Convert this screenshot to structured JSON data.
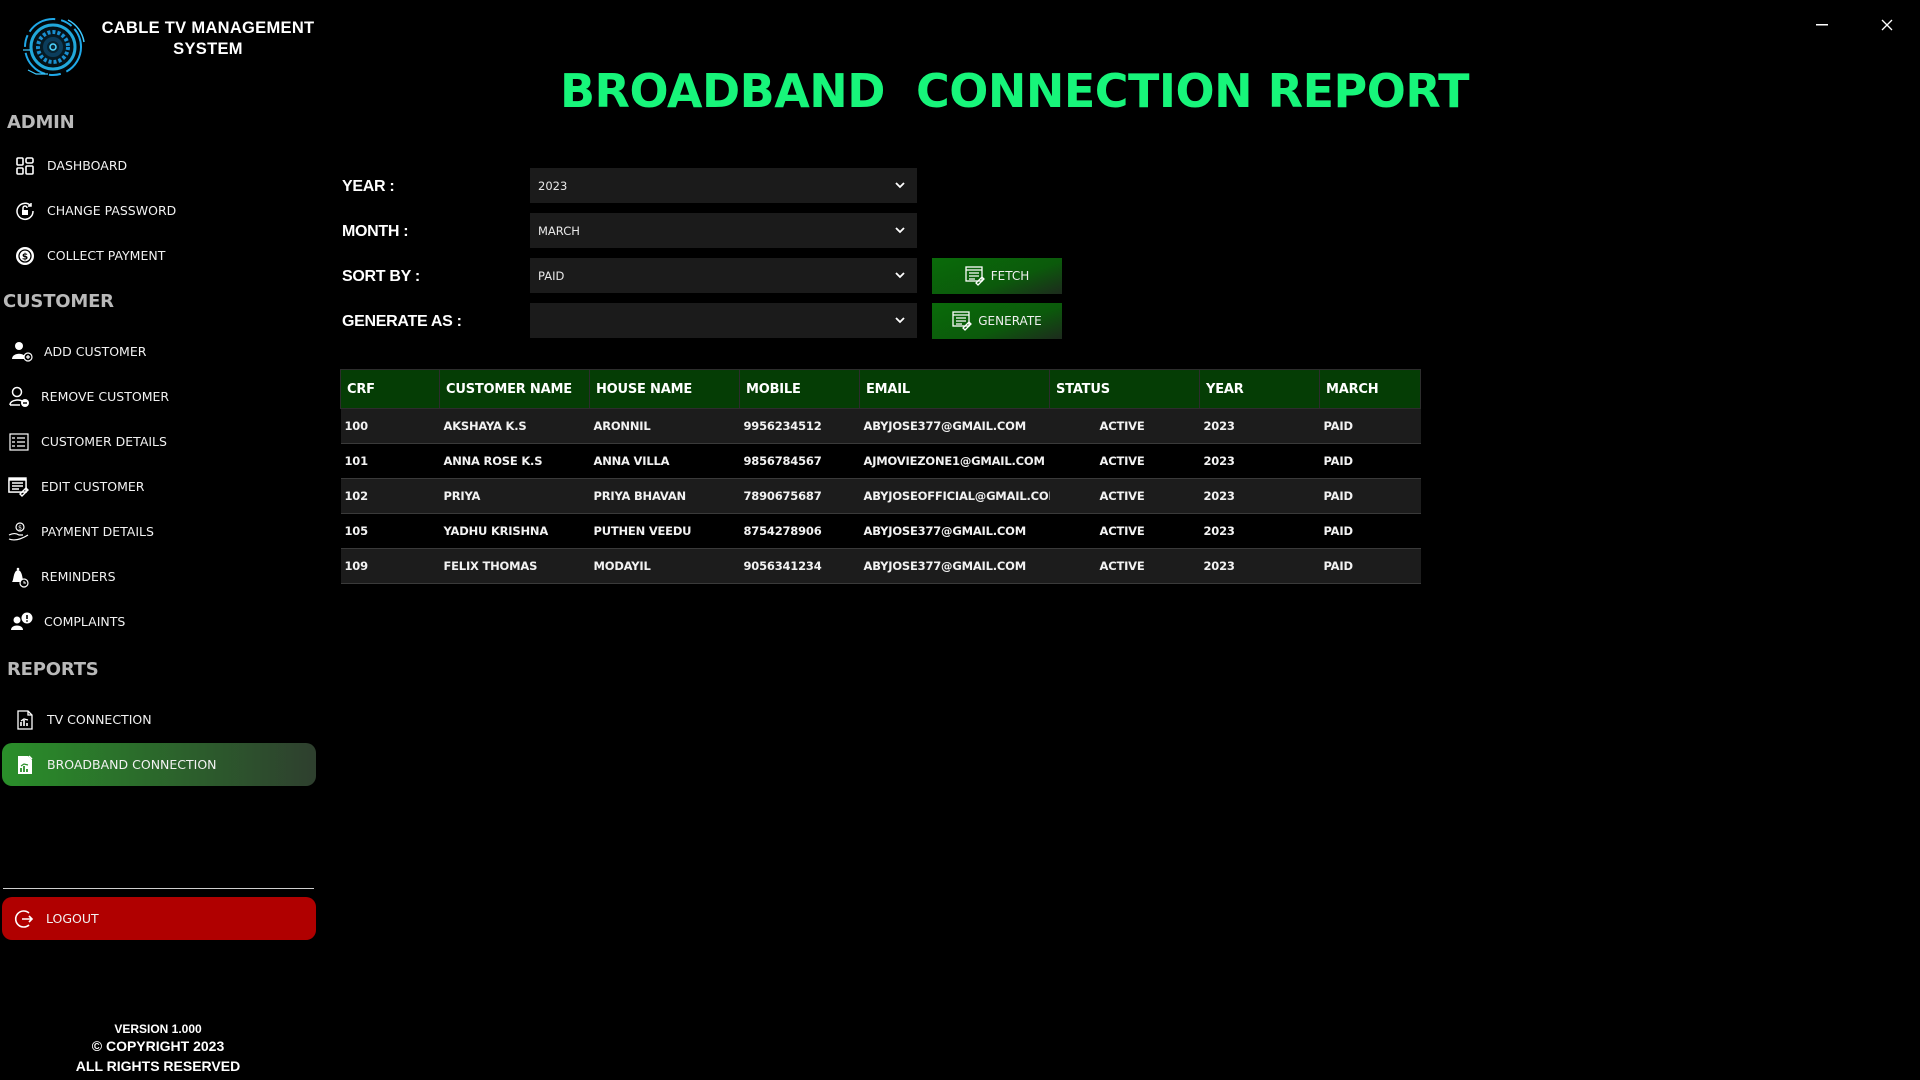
{
  "app": {
    "title_line1": "CABLE TV MANAGEMENT",
    "title_line2": "SYSTEM",
    "window_controls": {
      "minimize": "−",
      "close": "✕"
    }
  },
  "sidebar": {
    "sections": {
      "admin": "ADMIN",
      "customer": "CUSTOMER",
      "reports": "REPORTS"
    },
    "admin_items": [
      {
        "label": "DASHBOARD",
        "icon": "dashboard-icon"
      },
      {
        "label": "CHANGE PASSWORD",
        "icon": "unlock-icon"
      },
      {
        "label": "COLLECT PAYMENT",
        "icon": "coin-icon"
      }
    ],
    "customer_items": [
      {
        "label": "ADD CUSTOMER",
        "icon": "add-user-icon"
      },
      {
        "label": "REMOVE CUSTOMER",
        "icon": "remove-user-icon"
      },
      {
        "label": "CUSTOMER DETAILS",
        "icon": "details-list-icon"
      },
      {
        "label": "EDIT CUSTOMER",
        "icon": "edit-list-icon"
      },
      {
        "label": "PAYMENT DETAILS",
        "icon": "hand-coin-icon"
      },
      {
        "label": "REMINDERS",
        "icon": "bell-icon"
      },
      {
        "label": "COMPLAINTS",
        "icon": "complaint-icon"
      }
    ],
    "report_items": [
      {
        "label": "TV CONNECTION",
        "icon": "report-doc-icon",
        "active": false
      },
      {
        "label": "BROADBAND CONNECTION",
        "icon": "report-doc-icon",
        "active": true
      }
    ],
    "logout_label": "LOGOUT",
    "footer": {
      "version": "VERSION 1.000",
      "copyright": "© COPYRIGHT 2023",
      "rights": "ALL RIGHTS RESERVED"
    },
    "colors": {
      "active": "#2a8f2a",
      "logout": "#b00000"
    }
  },
  "main": {
    "title": "BROADBAND  CONNECTION REPORT",
    "title_color": "#17f57a",
    "form": {
      "year": {
        "label": "YEAR :",
        "value": "2023"
      },
      "month": {
        "label": "MONTH :",
        "value": "MARCH"
      },
      "sort_by": {
        "label": "SORT BY :",
        "value": "PAID"
      },
      "generate_as": {
        "label": "GENERATE AS :",
        "value": ""
      }
    },
    "buttons": {
      "fetch": "FETCH",
      "generate": "GENERATE"
    },
    "table": {
      "columns": [
        "CRF",
        "CUSTOMER NAME",
        "HOUSE NAME",
        "MOBILE",
        "EMAIL",
        "STATUS",
        "YEAR",
        "MARCH"
      ],
      "header_color": "#053d05",
      "rows": [
        [
          "100",
          "AKSHAYA K.S",
          "ARONNIL",
          "9956234512",
          "ABYJOSE377@GMAIL.COM",
          "ACTIVE",
          "2023",
          "PAID"
        ],
        [
          "101",
          "ANNA ROSE K.S",
          "ANNA VILLA",
          "9856784567",
          "AJMOVIEZONE1@GMAIL.COM",
          "ACTIVE",
          "2023",
          "PAID"
        ],
        [
          "102",
          "PRIYA",
          "PRIYA BHAVAN",
          "7890675687",
          "ABYJOSEOFFICIAL@GMAIL.COM",
          "ACTIVE",
          "2023",
          "PAID"
        ],
        [
          "105",
          "YADHU KRISHNA",
          "PUTHEN VEEDU",
          "8754278906",
          "ABYJOSE377@GMAIL.COM",
          "ACTIVE",
          "2023",
          "PAID"
        ],
        [
          "109",
          "FELIX THOMAS",
          "MODAYIL",
          "9056341234",
          "ABYJOSE377@GMAIL.COM",
          "ACTIVE",
          "2023",
          "PAID"
        ]
      ]
    }
  }
}
